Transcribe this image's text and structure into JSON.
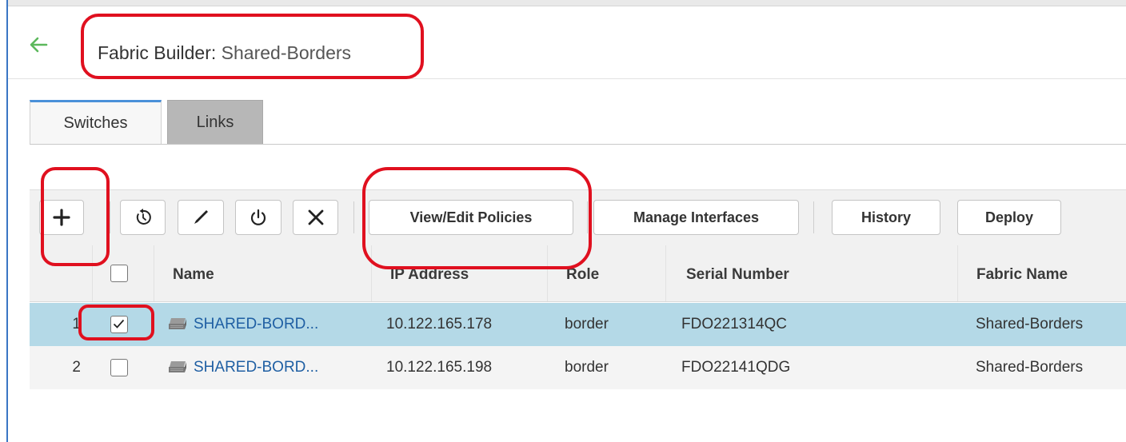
{
  "page": {
    "title_prefix": "Fabric Builder:",
    "title_name": "Shared-Borders"
  },
  "tabs": [
    {
      "label": "Switches",
      "active": true
    },
    {
      "label": "Links",
      "active": false
    }
  ],
  "toolbar": {
    "icon_buttons": [
      {
        "name": "add",
        "icon": "plus-icon"
      },
      {
        "name": "discover",
        "icon": "refresh-icon"
      },
      {
        "name": "edit",
        "icon": "pencil-icon"
      },
      {
        "name": "reload",
        "icon": "power-icon"
      },
      {
        "name": "delete",
        "icon": "close-icon"
      }
    ],
    "view_edit_policies": "View/Edit Policies",
    "manage_interfaces": "Manage Interfaces",
    "history": "History",
    "deploy": "Deploy"
  },
  "table": {
    "columns": [
      "Name",
      "IP Address",
      "Role",
      "Serial Number",
      "Fabric Name"
    ],
    "rows": [
      {
        "index": "1",
        "checked": true,
        "name": "SHARED-BORD...",
        "ip": "10.122.165.178",
        "role": "border",
        "serial": "FDO221314QC",
        "fabric": "Shared-Borders",
        "selected": true
      },
      {
        "index": "2",
        "checked": false,
        "name": "SHARED-BORD...",
        "ip": "10.122.165.198",
        "role": "border",
        "serial": "FDO22141QDG",
        "fabric": "Shared-Borders",
        "selected": false
      }
    ]
  },
  "colors": {
    "accent": "#4a90d9",
    "back_arrow": "#5cb85c",
    "selected_row": "#b4d9e7",
    "link": "#1f5fa3",
    "annotation": "#e0101f"
  }
}
